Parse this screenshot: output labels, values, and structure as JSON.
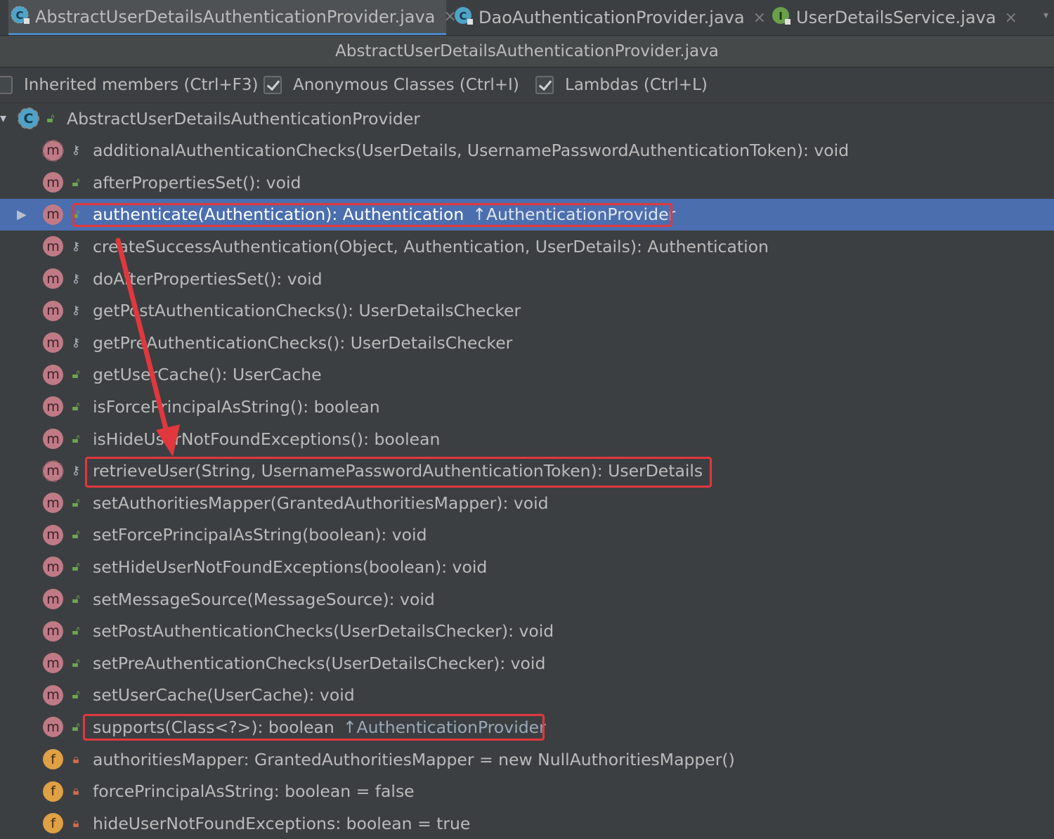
{
  "tabs": [
    {
      "label": "AbstractUserDetailsAuthenticationProvider.java",
      "icon": "abstract-class-icon",
      "active": true
    },
    {
      "label": "DaoAuthenticationProvider.java",
      "icon": "class-icon",
      "active": false
    },
    {
      "label": "UserDetailsService.java",
      "icon": "interface-icon",
      "active": false
    }
  ],
  "tab_close_glyph": "×",
  "tab_menu_glyph": "▾",
  "title": "AbstractUserDetailsAuthenticationProvider.java",
  "options": [
    {
      "label": "Inherited members (Ctrl+F3)",
      "checked": false
    },
    {
      "label": "Anonymous Classes (Ctrl+I)",
      "checked": true
    },
    {
      "label": "Lambdas (Ctrl+L)",
      "checked": true
    }
  ],
  "tree": {
    "root_label": "AbstractUserDetailsAuthenticationProvider",
    "class_badge": "C",
    "method_badge": "m",
    "field_badge": "f",
    "members": [
      {
        "text": "additionalAuthenticationChecks(UserDetails, UsernamePasswordAuthenticationToken): void",
        "kind": "m",
        "visibility": "protected",
        "abstract": true
      },
      {
        "text": "afterPropertiesSet(): void",
        "kind": "m",
        "visibility": "public",
        "overrides": true
      },
      {
        "text": "authenticate(Authentication): Authentication",
        "inherited": "↑AuthenticationProvider",
        "kind": "m",
        "visibility": "public",
        "selected": true,
        "expandable": true
      },
      {
        "text": "createSuccessAuthentication(Object, Authentication, UserDetails): Authentication",
        "kind": "m",
        "visibility": "protected"
      },
      {
        "text": "doAfterPropertiesSet(): void",
        "kind": "m",
        "visibility": "protected"
      },
      {
        "text": "getPostAuthenticationChecks(): UserDetailsChecker",
        "kind": "m",
        "visibility": "protected"
      },
      {
        "text": "getPreAuthenticationChecks(): UserDetailsChecker",
        "kind": "m",
        "visibility": "protected"
      },
      {
        "text": "getUserCache(): UserCache",
        "kind": "m",
        "visibility": "public"
      },
      {
        "text": "isForcePrincipalAsString(): boolean",
        "kind": "m",
        "visibility": "public"
      },
      {
        "text": "isHideUserNotFoundExceptions(): boolean",
        "kind": "m",
        "visibility": "public"
      },
      {
        "text": "retrieveUser(String, UsernamePasswordAuthenticationToken): UserDetails",
        "kind": "m",
        "visibility": "protected",
        "abstract": true
      },
      {
        "text": "setAuthoritiesMapper(GrantedAuthoritiesMapper): void",
        "kind": "m",
        "visibility": "public"
      },
      {
        "text": "setForcePrincipalAsString(boolean): void",
        "kind": "m",
        "visibility": "public"
      },
      {
        "text": "setHideUserNotFoundExceptions(boolean): void",
        "kind": "m",
        "visibility": "public"
      },
      {
        "text": "setMessageSource(MessageSource): void",
        "kind": "m",
        "visibility": "public"
      },
      {
        "text": "setPostAuthenticationChecks(UserDetailsChecker): void",
        "kind": "m",
        "visibility": "public"
      },
      {
        "text": "setPreAuthenticationChecks(UserDetailsChecker): void",
        "kind": "m",
        "visibility": "public"
      },
      {
        "text": "setUserCache(UserCache): void",
        "kind": "m",
        "visibility": "public"
      },
      {
        "text": "supports(Class<?>): boolean",
        "inherited": "↑AuthenticationProvider",
        "kind": "m",
        "visibility": "public"
      },
      {
        "text": "authoritiesMapper: GrantedAuthoritiesMapper = new NullAuthoritiesMapper()",
        "kind": "f",
        "visibility": "private"
      },
      {
        "text": "forcePrincipalAsString: boolean = false",
        "kind": "f",
        "visibility": "private"
      },
      {
        "text": "hideUserNotFoundExceptions: boolean = true",
        "kind": "f",
        "visibility": "private"
      }
    ]
  },
  "colors": {
    "background": "#3c3f41",
    "selection": "#4b6eaf",
    "annotation_red": "#e0383e",
    "method_badge": "#c07a86",
    "field_badge": "#e0a044",
    "public_icon": "#6aa84f"
  }
}
